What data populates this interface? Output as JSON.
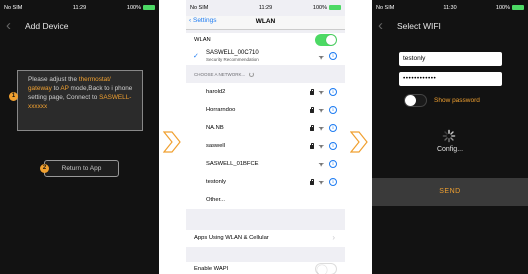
{
  "panel1": {
    "status": {
      "carrier": "No SIM",
      "time": "11:29",
      "battery": "100%"
    },
    "title": "Add Device",
    "message": {
      "line1": "Please adjust the ",
      "thermostat": "thermostat/",
      "gateway": "gateway",
      "to": " to ",
      "ap": "AP",
      "rest": " mode,Back to i phone setting page, Connect to ",
      "ssid": "SASWELL-xxxxxx"
    },
    "step1": "1",
    "step2": "2",
    "return_label": "Return to App"
  },
  "panel2": {
    "status": {
      "carrier": "No SIM",
      "time": "11:29",
      "battery": "100%"
    },
    "back_label": "Settings",
    "title": "WLAN",
    "wlan_label": "WLAN",
    "connected": {
      "name": "SASWELL_00C710",
      "sub": "Security Recommendation"
    },
    "choose_header": "CHOOSE A NETWORK...",
    "networks": [
      {
        "name": "harold2"
      },
      {
        "name": "Horrarndoo"
      },
      {
        "name": "NA.NB"
      },
      {
        "name": "saswell"
      },
      {
        "name": "SASWELL_01BFCE"
      },
      {
        "name": "testonly"
      }
    ],
    "other": "Other...",
    "apps_label": "Apps Using WLAN & Cellular",
    "wapi_label": "Enable WAPI",
    "colors": {
      "accent": "#1e7cf2",
      "switch_on": "#4cd964"
    }
  },
  "panel3": {
    "status": {
      "carrier": "No SIM",
      "time": "11:30",
      "battery": "100%"
    },
    "title": "Select WIFI",
    "ssid_value": "testonly",
    "password_value": "••••••••••••",
    "show_password": "Show password",
    "config_label": "Config...",
    "send_label": "SEND",
    "colors": {
      "accent": "#f0a030"
    }
  }
}
